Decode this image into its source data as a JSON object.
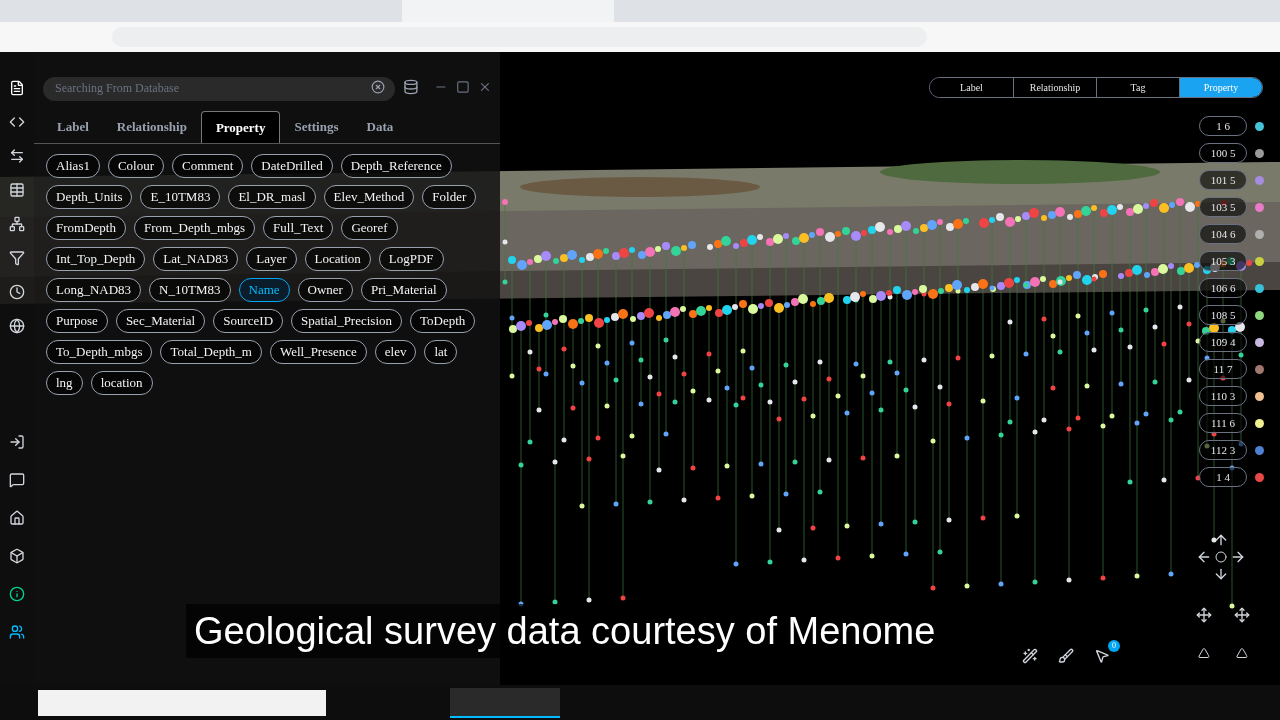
{
  "search": {
    "placeholder": "Searching From Database"
  },
  "panel_tabs": [
    {
      "label": "Label",
      "selected": false
    },
    {
      "label": "Relationship",
      "selected": false
    },
    {
      "label": "Property",
      "selected": true
    },
    {
      "label": "Settings",
      "selected": false
    },
    {
      "label": "Data",
      "selected": false
    }
  ],
  "properties": [
    {
      "label": "Alias1",
      "selected": false
    },
    {
      "label": "Colour",
      "selected": false
    },
    {
      "label": "Comment",
      "selected": false
    },
    {
      "label": "DateDrilled",
      "selected": false
    },
    {
      "label": "Depth_Reference",
      "selected": false
    },
    {
      "label": "Depth_Units",
      "selected": false
    },
    {
      "label": "E_10TM83",
      "selected": false
    },
    {
      "label": "El_DR_masl",
      "selected": false
    },
    {
      "label": "Elev_Method",
      "selected": false
    },
    {
      "label": "Folder",
      "selected": false
    },
    {
      "label": "FromDepth",
      "selected": false
    },
    {
      "label": "From_Depth_mbgs",
      "selected": false
    },
    {
      "label": "Full_Text",
      "selected": false
    },
    {
      "label": "Georef",
      "selected": false
    },
    {
      "label": "Int_Top_Depth",
      "selected": false
    },
    {
      "label": "Lat_NAD83",
      "selected": false
    },
    {
      "label": "Layer",
      "selected": false
    },
    {
      "label": "Location",
      "selected": false
    },
    {
      "label": "LogPDF",
      "selected": false
    },
    {
      "label": "Long_NAD83",
      "selected": false
    },
    {
      "label": "N_10TM83",
      "selected": false
    },
    {
      "label": "Name",
      "selected": true
    },
    {
      "label": "Owner",
      "selected": false
    },
    {
      "label": "Pri_Material",
      "selected": false
    },
    {
      "label": "Purpose",
      "selected": false
    },
    {
      "label": "Sec_Material",
      "selected": false
    },
    {
      "label": "SourceID",
      "selected": false
    },
    {
      "label": "Spatial_Precision",
      "selected": false
    },
    {
      "label": "ToDepth",
      "selected": false
    },
    {
      "label": "To_Depth_mbgs",
      "selected": false
    },
    {
      "label": "Total_Depth_m",
      "selected": false
    },
    {
      "label": "Well_Presence",
      "selected": false
    },
    {
      "label": "elev",
      "selected": false
    },
    {
      "label": "lat",
      "selected": false
    },
    {
      "label": "lng",
      "selected": false
    },
    {
      "label": "location",
      "selected": false
    }
  ],
  "view_tabs": [
    {
      "label": "Label",
      "selected": false
    },
    {
      "label": "Relationship",
      "selected": false
    },
    {
      "label": "Tag",
      "selected": false
    },
    {
      "label": "Property",
      "selected": true
    }
  ],
  "legend": [
    {
      "label": "1 6",
      "color": "#45c4d8"
    },
    {
      "label": "100 5",
      "color": "#9a9a9a"
    },
    {
      "label": "101 5",
      "color": "#a78be0"
    },
    {
      "label": "103 5",
      "color": "#e87cc8"
    },
    {
      "label": "104 6",
      "color": "#b0b0b0"
    },
    {
      "label": "105 3",
      "color": "#c8d040"
    },
    {
      "label": "106 6",
      "color": "#38c0d8"
    },
    {
      "label": "108 5",
      "color": "#90d880"
    },
    {
      "label": "109 4",
      "color": "#c8b8e0"
    },
    {
      "label": "11 7",
      "color": "#a07870"
    },
    {
      "label": "110 3",
      "color": "#f0c090"
    },
    {
      "label": "111 6",
      "color": "#f0f090"
    },
    {
      "label": "112 3",
      "color": "#5080d0"
    },
    {
      "label": "1 4",
      "color": "#e84848"
    }
  ],
  "caption": "Geological survey data courtesy of Menome",
  "notification_count": "0"
}
